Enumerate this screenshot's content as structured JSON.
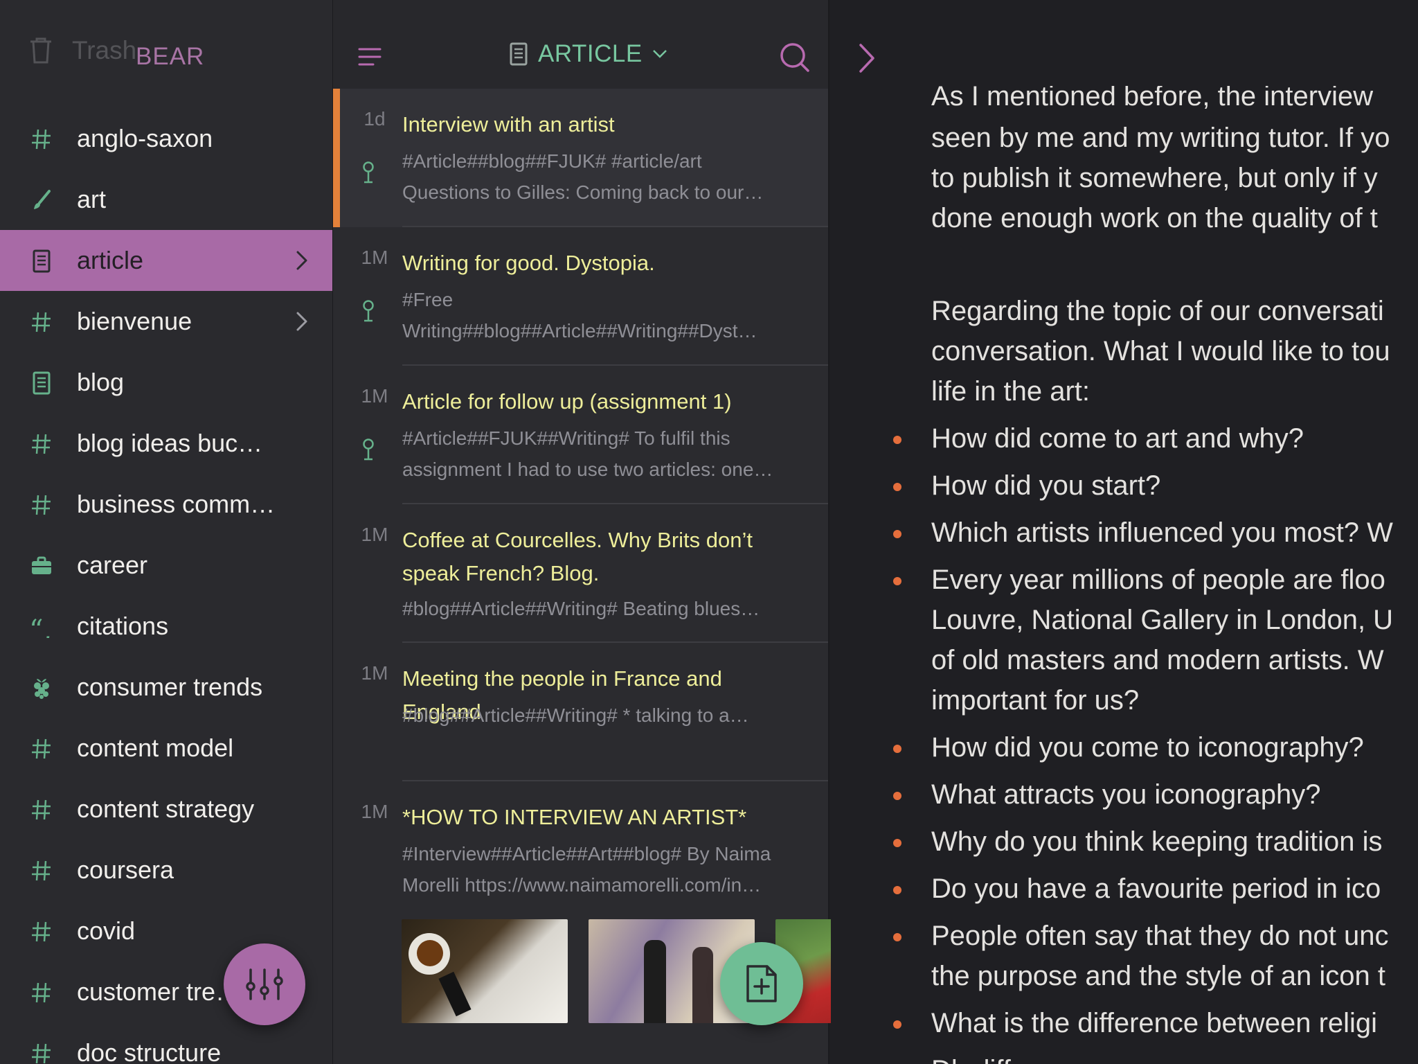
{
  "sidebar": {
    "ghost_label": "Trash",
    "title": "BEAR",
    "tags": [
      {
        "label": "anglo-saxon",
        "icon": "hashtag-icon",
        "chevron": false
      },
      {
        "label": "art",
        "icon": "brush-icon",
        "chevron": false
      },
      {
        "label": "article",
        "icon": "notebook-icon",
        "chevron": true,
        "selected": true
      },
      {
        "label": "bienvenue",
        "icon": "hashtag-icon",
        "chevron": true
      },
      {
        "label": "blog",
        "icon": "notebook-icon",
        "chevron": false
      },
      {
        "label": "blog ideas buc…",
        "icon": "hashtag-icon",
        "chevron": false
      },
      {
        "label": "business comm…",
        "icon": "hashtag-icon",
        "chevron": false
      },
      {
        "label": "career",
        "icon": "briefcase-icon",
        "chevron": false
      },
      {
        "label": "citations",
        "icon": "quote-icon",
        "chevron": false
      },
      {
        "label": "consumer trends",
        "icon": "raspberry-icon",
        "chevron": false
      },
      {
        "label": "content model",
        "icon": "hashtag-icon",
        "chevron": false
      },
      {
        "label": "content strategy",
        "icon": "hashtag-icon",
        "chevron": false
      },
      {
        "label": "coursera",
        "icon": "hashtag-icon",
        "chevron": false
      },
      {
        "label": "covid",
        "icon": "hashtag-icon",
        "chevron": false
      },
      {
        "label": "customer tre…",
        "icon": "hashtag-icon",
        "chevron": false
      },
      {
        "label": "doc structure",
        "icon": "hashtag-icon",
        "chevron": false
      }
    ]
  },
  "notelist": {
    "title": "ARTICLE",
    "notes": [
      {
        "age": "1d",
        "title": "Interview with an artist",
        "body": [
          "#Article##blog##FJUK# #article/art",
          "Questions to Gilles: Coming back to our…"
        ],
        "pinned": true,
        "active": true
      },
      {
        "age": "1M",
        "title": "Writing for good. Dystopia.",
        "body": [
          "#Free",
          "Writing##blog##Article##Writing##Dyst…"
        ],
        "pinned": true
      },
      {
        "age": "1M",
        "title": "Article for follow up (assignment 1)",
        "body": [
          "#Article##FJUK##Writing# To fulfil this",
          "assignment I had to use two articles: one…"
        ],
        "pinned": true
      },
      {
        "age": "1M",
        "title": "Coffee at Courcelles. Why Brits don’t speak French? Blog.",
        "body": [
          "#blog##Article##Writing# Beating blues…"
        ],
        "pinned": false
      },
      {
        "age": "1M",
        "title": "Meeting the people in France and England",
        "body": [
          "#blog##Article##Writing# * talking to a…"
        ],
        "pinned": false
      },
      {
        "age": "1M",
        "title": "*HOW TO INTERVIEW AN ARTIST*",
        "body": [
          "#Interview##Article##Art##blog# By Naima",
          "Morelli https://www.naimamorelli.com/in…"
        ],
        "pinned": false
      }
    ]
  },
  "editor": {
    "first_line": "As I mentioned before, the interview",
    "para1": [
      "seen by me and my writing tutor. If yo",
      "to publish it somewhere, but only if y",
      "done enough work on the quality of t"
    ],
    "para2": [
      "Regarding the topic of our conversati",
      "conversation. What I would like to tou",
      "life in the art:"
    ],
    "bullets": [
      [
        "How did come to art and why?"
      ],
      [
        "How did you start?"
      ],
      [
        "Which artists influenced you most? W"
      ],
      [
        "Every year millions of people are floo",
        "Louvre, National Gallery in London, U",
        "of old masters and modern artists. W",
        "important for us?"
      ],
      [
        "How did you come to iconography?"
      ],
      [
        "What attracts you iconography?"
      ],
      [
        "Why do you think keeping tradition is"
      ],
      [
        "Do you have a favourite period in ico"
      ],
      [
        "People often say that they do not unc",
        "the purpose and the style of an icon t"
      ],
      [
        "What is the difference between religi"
      ],
      [
        "Db              diffe"
      ]
    ]
  },
  "colors": {
    "accent_purple": "#a86aa6",
    "accent_green": "#66b18b",
    "note_title": "#eeee9a",
    "active_bar": "#e3813a",
    "bullet": "#e56e3c"
  }
}
